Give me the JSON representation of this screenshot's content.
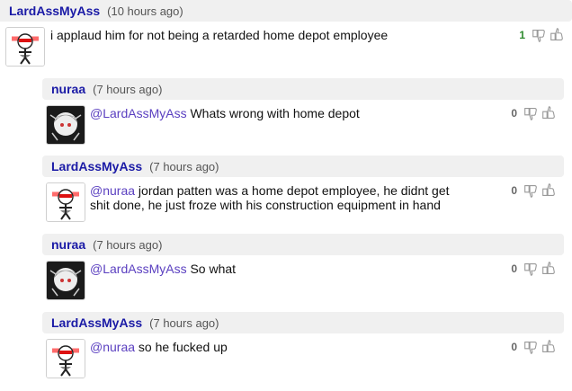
{
  "comments": [
    {
      "user": "LardAssMyAss",
      "time": "(10 hours ago)",
      "mention": "",
      "text": "i applaud him for not being a retarded home depot employee",
      "score": "1",
      "avatar": "red-eyes-avatar"
    },
    {
      "user": "nuraa",
      "time": "(7 hours ago)",
      "mention": "@LardAssMyAss",
      "text": "Whats wrong with home depot",
      "score": "0",
      "avatar": "anime-avatar"
    },
    {
      "user": "LardAssMyAss",
      "time": "(7 hours ago)",
      "mention": "@nuraa",
      "text": "jordan patten was a home depot employee, he didnt get shit done, he just froze with his construction equipment in hand",
      "score": "0",
      "avatar": "red-eyes-avatar"
    },
    {
      "user": "nuraa",
      "time": "(7 hours ago)",
      "mention": "@LardAssMyAss",
      "text": "So what",
      "score": "0",
      "avatar": "anime-avatar"
    },
    {
      "user": "LardAssMyAss",
      "time": "(7 hours ago)",
      "mention": "@nuraa",
      "text": "so he fucked up",
      "score": "0",
      "avatar": "red-eyes-avatar"
    }
  ],
  "colors": {
    "username": "#1a1aa6",
    "mention": "#5a3fc0",
    "positive_score": "#2e8b2e",
    "header_bg": "#f0f0f0"
  }
}
